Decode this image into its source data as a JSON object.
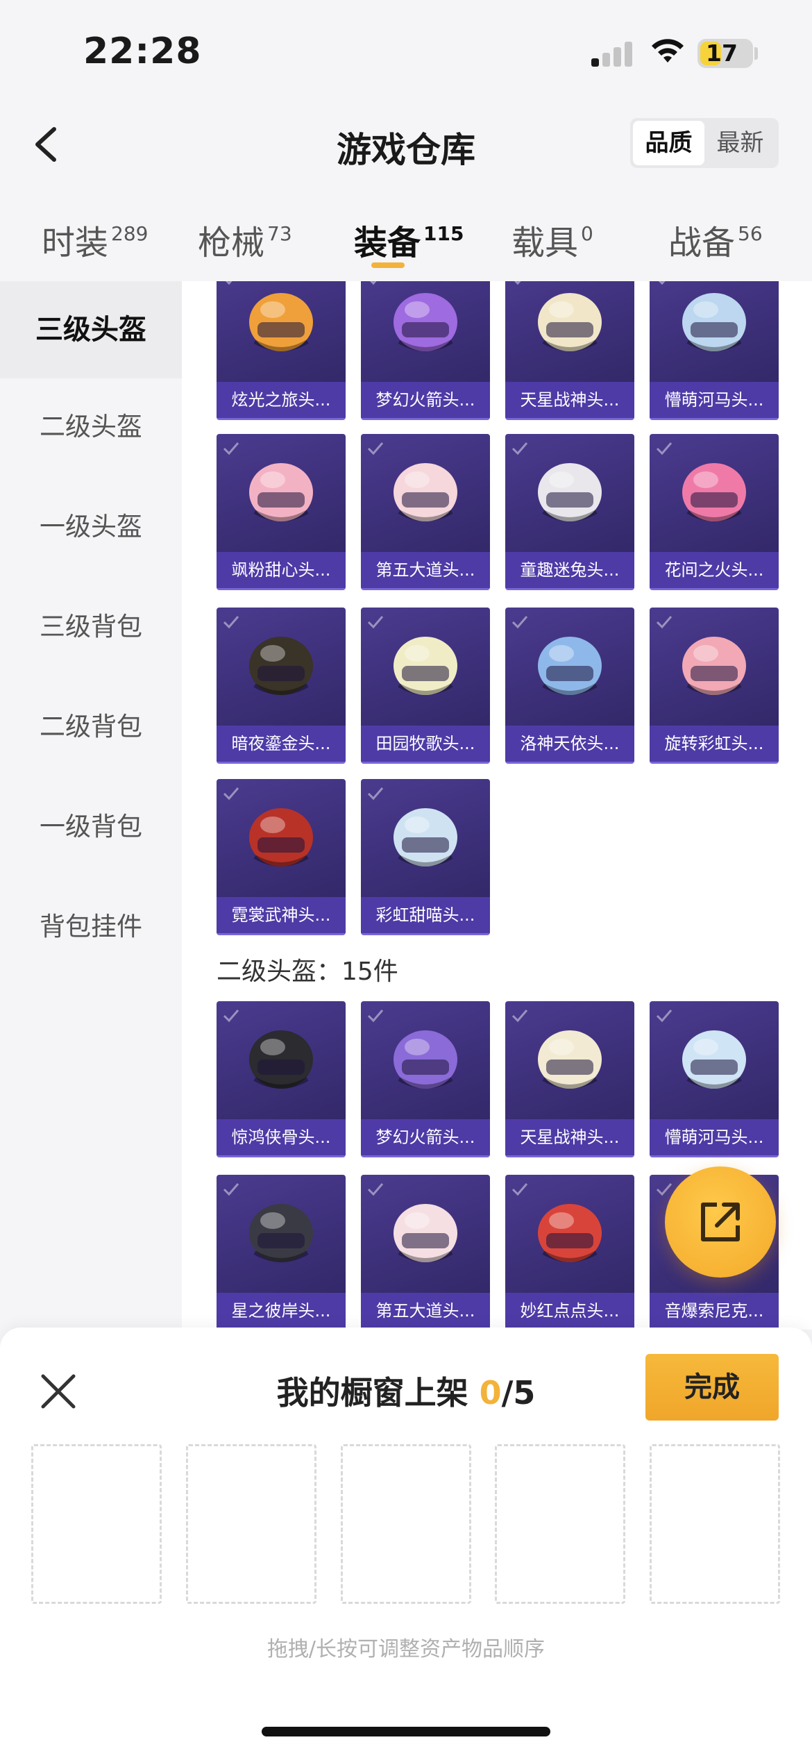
{
  "status": {
    "time": "22:28",
    "battery": "17"
  },
  "header": {
    "title": "游戏仓库",
    "sort_options": [
      "品质",
      "最新"
    ],
    "active_sort": "品质"
  },
  "tabs": [
    {
      "label": "时装",
      "count": "289"
    },
    {
      "label": "枪械",
      "count": "73"
    },
    {
      "label": "装备",
      "count": "115"
    },
    {
      "label": "载具",
      "count": "0"
    },
    {
      "label": "战备",
      "count": "56"
    }
  ],
  "active_tab": "装备",
  "sidebar": [
    {
      "label": "三级头盔"
    },
    {
      "label": "二级头盔"
    },
    {
      "label": "一级头盔"
    },
    {
      "label": "三级背包"
    },
    {
      "label": "二级背包"
    },
    {
      "label": "一级背包"
    },
    {
      "label": "背包挂件"
    }
  ],
  "active_side": "三级头盔",
  "level3_items": [
    {
      "label": "炫光之旅头...",
      "color": "#f0a03a"
    },
    {
      "label": "梦幻火箭头...",
      "color": "#9f6be0"
    },
    {
      "label": "天星战神头...",
      "color": "#f1e6c8"
    },
    {
      "label": "懵萌河马头...",
      "color": "#bcd7ef"
    },
    {
      "label": "飒粉甜心头...",
      "color": "#f3b2c4"
    },
    {
      "label": "第五大道头...",
      "color": "#f5d7dc"
    },
    {
      "label": "童趣迷兔头...",
      "color": "#e9e6ec"
    },
    {
      "label": "花间之火头...",
      "color": "#ef7aa8"
    },
    {
      "label": "暗夜鎏金头...",
      "color": "#3a3328"
    },
    {
      "label": "田园牧歌头...",
      "color": "#f0ecc6"
    },
    {
      "label": "洛神天依头...",
      "color": "#8fb8ea"
    },
    {
      "label": "旋转彩虹头...",
      "color": "#f2a8b5"
    },
    {
      "label": "霓裳武神头...",
      "color": "#b83228"
    },
    {
      "label": "彩虹甜喵头...",
      "color": "#cfe2f2"
    }
  ],
  "level2_heading": "二级头盔：15件",
  "level2_items": [
    {
      "label": "惊鸿侠骨头...",
      "color": "#2b2b30"
    },
    {
      "label": "梦幻火箭头...",
      "color": "#8a6bd8"
    },
    {
      "label": "天星战神头...",
      "color": "#f2ead2"
    },
    {
      "label": "懵萌河马头...",
      "color": "#cfe4f5"
    },
    {
      "label": "星之彼岸头...",
      "color": "#3a3a44"
    },
    {
      "label": "第五大道头...",
      "color": "#f5dfe3"
    },
    {
      "label": "妙红点点头...",
      "color": "#d9443a"
    },
    {
      "label": "音爆索尼克...",
      "color": "#3a4fb8"
    }
  ],
  "sheet": {
    "title": "我的橱窗上架",
    "current": "0",
    "total": "/5",
    "done_label": "完成",
    "slot_count": 5,
    "hint": "拖拽/长按可调整资产物品顺序"
  },
  "colors": {
    "accent": "#f3b23a",
    "card_bg": "#3c2f78",
    "card_label_bg": "#503caa"
  }
}
